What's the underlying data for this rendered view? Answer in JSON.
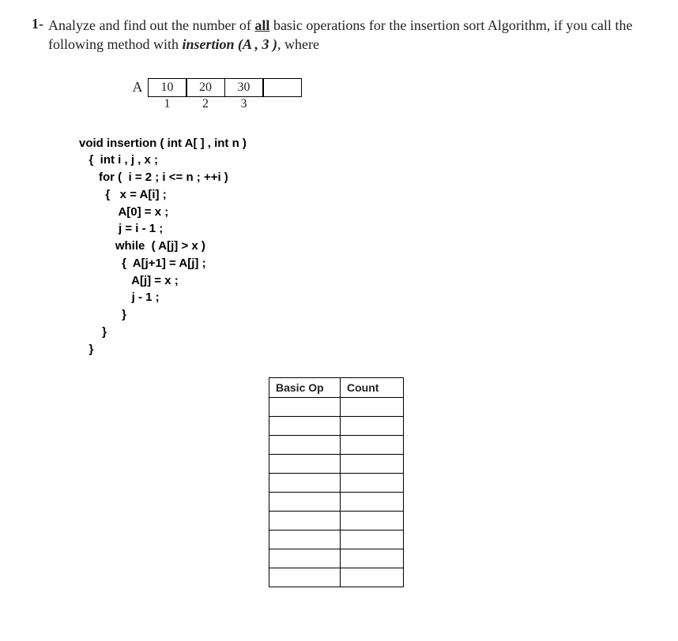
{
  "question": {
    "number": "1-",
    "text_prefix": "Analyze and find out the number of ",
    "all_word": "all",
    "text_middle": " basic operations for the insertion sort Algorithm, if you call the following method with ",
    "call": "insertion (A , 3 )",
    "text_suffix": ", where"
  },
  "array": {
    "label": "A",
    "cells": [
      "10",
      "20",
      "30",
      ""
    ],
    "indices": [
      "1",
      "2",
      "3",
      ""
    ]
  },
  "code": {
    "l01": "void insertion ( int A[ ] , int n )",
    "l02": "   {  int i , j , x ;",
    "l03": "      for (  i = 2 ; i <= n ; ++i )",
    "l04": "        {   x = A[i] ;",
    "l05": "            A[0] = x ;",
    "l06": "            j = i - 1 ;",
    "l07": "           while  ( A[j] > x )",
    "l08": "             {  A[j+1] = A[j] ;",
    "l09": "                A[j] = x ;",
    "l10": "                j - 1 ;",
    "l11": "             }",
    "l12": "       }",
    "l13": "   }"
  },
  "table": {
    "header_op": "Basic Op",
    "header_count": "Count",
    "rows": 10
  }
}
